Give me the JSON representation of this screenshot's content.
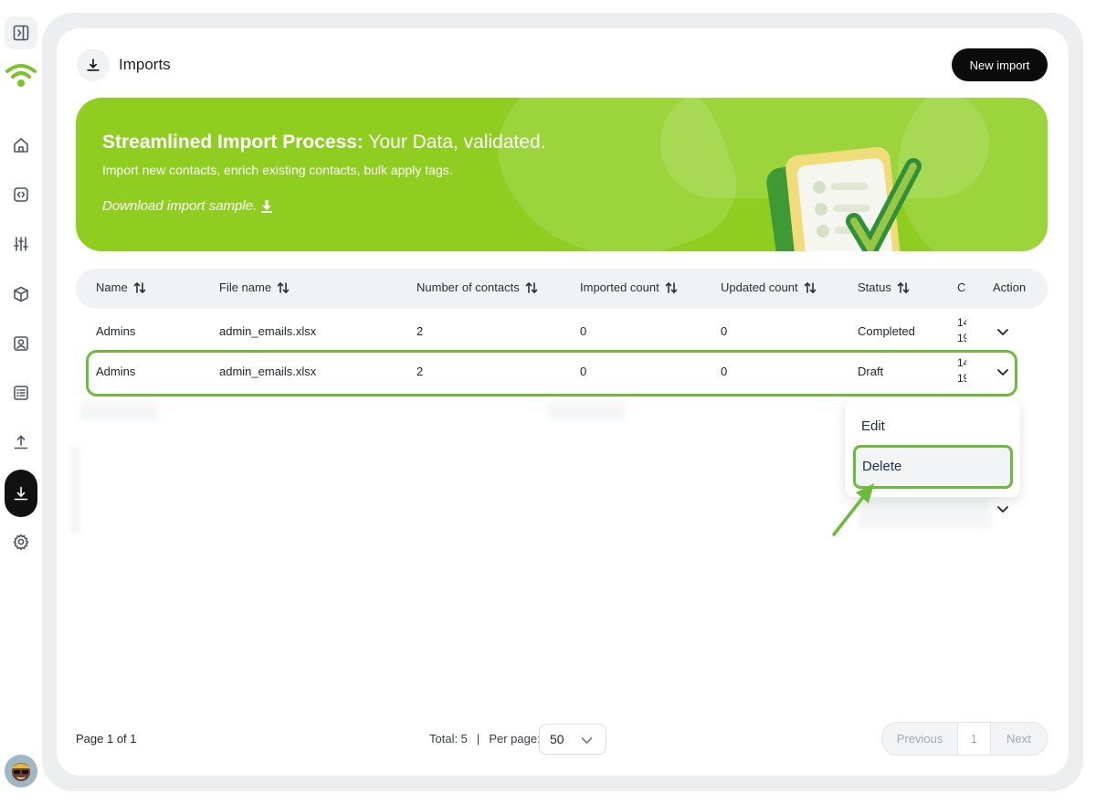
{
  "header": {
    "title": "Imports",
    "new_import_label": "New import"
  },
  "banner": {
    "title_bold": "Streamlined Import Process:",
    "title_rest": " Your Data, validated.",
    "subtitle": "Import new contacts, enrich existing contacts, bulk apply tags.",
    "download_link": "Download import sample."
  },
  "table": {
    "columns": [
      "Name",
      "File name",
      "Number of contacts",
      "Imported count",
      "Updated count",
      "Status",
      "C",
      "Action"
    ],
    "rows": [
      {
        "name": "Admins",
        "file_name": "admin_emails.xlsx",
        "contacts": "2",
        "imported": "0",
        "updated": "0",
        "status": "Completed",
        "created_line1": "14",
        "created_line2": "19"
      },
      {
        "name": "Admins",
        "file_name": "admin_emails.xlsx",
        "contacts": "2",
        "imported": "0",
        "updated": "0",
        "status": "Draft",
        "created_line1": "14",
        "created_line2": "19"
      }
    ]
  },
  "menu": {
    "edit_label": "Edit",
    "delete_label": "Delete"
  },
  "footer": {
    "page_info": "Page 1 of 1",
    "total": "Total: 5",
    "separator": "|",
    "per_page_label": "Per page:",
    "per_page_value": "50",
    "previous_label": "Previous",
    "current_page": "1",
    "next_label": "Next"
  },
  "sidebar": {
    "icons": [
      "panel-toggle-icon",
      "logo-icon",
      "home-icon",
      "code-icon",
      "sliders-icon",
      "cube-icon",
      "contact-icon",
      "list-icon",
      "upload-icon",
      "download-icon",
      "settings-icon"
    ]
  },
  "colors": {
    "accent_green": "#8fce21",
    "highlight_green": "#6dbb3e",
    "dark": "#0b0b0b"
  }
}
